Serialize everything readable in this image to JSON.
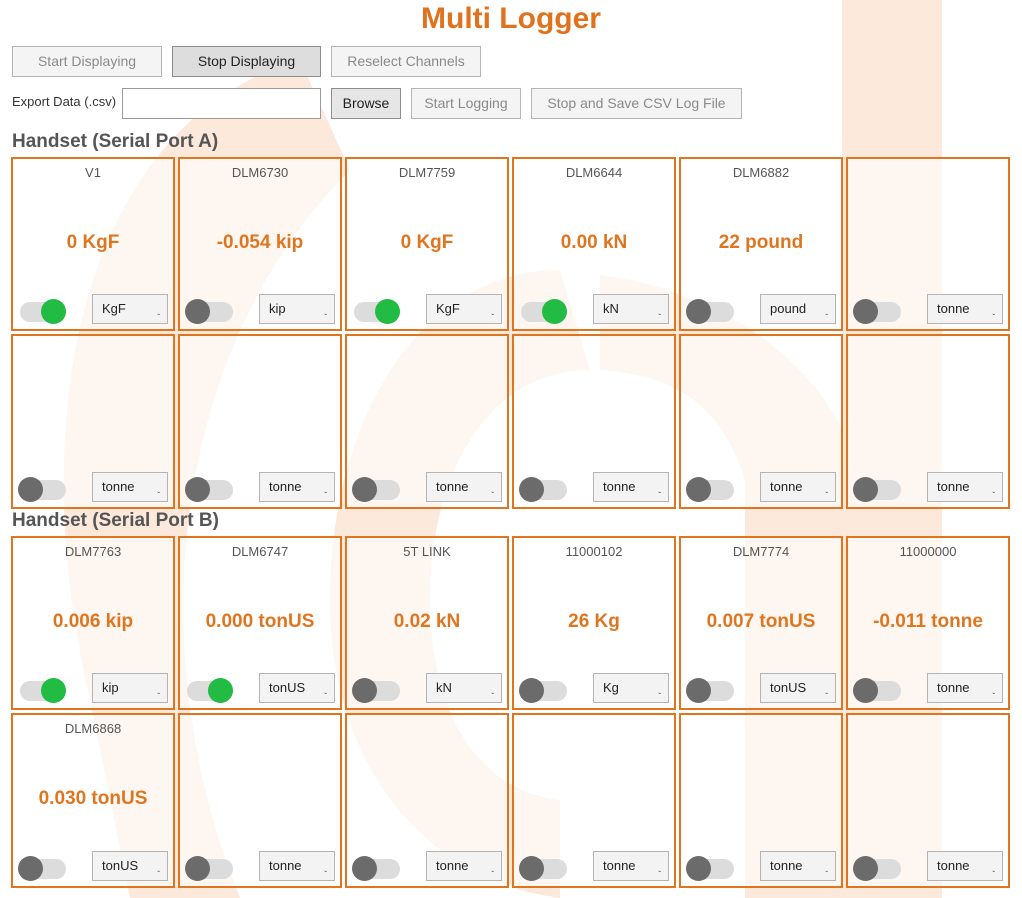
{
  "title": "Multi Logger",
  "toolbar": {
    "start_displaying": "Start Displaying",
    "stop_displaying": "Stop Displaying",
    "reselect_channels": "Reselect Channels",
    "export_label": "Export Data (.csv)",
    "export_value": "",
    "browse": "Browse",
    "start_logging": "Start Logging",
    "stop_save": "Stop and Save CSV Log File"
  },
  "colors": {
    "accent": "#e07520",
    "toggle_on": "#22bb44",
    "toggle_off": "#6b6b6b"
  },
  "sections": [
    {
      "title": "Handset (Serial Port A)",
      "channels": [
        {
          "name": "V1",
          "value": "0 KgF",
          "unit": "KgF",
          "enabled": true
        },
        {
          "name": "DLM6730",
          "value": "-0.054 kip",
          "unit": "kip",
          "enabled": false
        },
        {
          "name": "DLM7759",
          "value": "0 KgF",
          "unit": "KgF",
          "enabled": true
        },
        {
          "name": "DLM6644",
          "value": "0.00 kN",
          "unit": "kN",
          "enabled": true
        },
        {
          "name": "DLM6882",
          "value": "22 pound",
          "unit": "pound",
          "enabled": false
        },
        {
          "name": "",
          "value": "",
          "unit": "tonne",
          "enabled": false
        },
        {
          "name": "",
          "value": "",
          "unit": "tonne",
          "enabled": false
        },
        {
          "name": "",
          "value": "",
          "unit": "tonne",
          "enabled": false
        },
        {
          "name": "",
          "value": "",
          "unit": "tonne",
          "enabled": false
        },
        {
          "name": "",
          "value": "",
          "unit": "tonne",
          "enabled": false
        },
        {
          "name": "",
          "value": "",
          "unit": "tonne",
          "enabled": false
        },
        {
          "name": "",
          "value": "",
          "unit": "tonne",
          "enabled": false
        }
      ]
    },
    {
      "title": "Handset (Serial Port B)",
      "channels": [
        {
          "name": "DLM7763",
          "value": "0.006 kip",
          "unit": "kip",
          "enabled": true
        },
        {
          "name": "DLM6747",
          "value": "0.000 tonUS",
          "unit": "tonUS",
          "enabled": true
        },
        {
          "name": "5T LINK",
          "value": "0.02 kN",
          "unit": "kN",
          "enabled": false
        },
        {
          "name": "11000102",
          "value": "26 Kg",
          "unit": "Kg",
          "enabled": false
        },
        {
          "name": "DLM7774",
          "value": "0.007 tonUS",
          "unit": "tonUS",
          "enabled": false
        },
        {
          "name": "11000000",
          "value": "-0.011 tonne",
          "unit": "tonne",
          "enabled": false
        },
        {
          "name": "DLM6868",
          "value": "0.030 tonUS",
          "unit": "tonUS",
          "enabled": false
        },
        {
          "name": "",
          "value": "",
          "unit": "tonne",
          "enabled": false
        },
        {
          "name": "",
          "value": "",
          "unit": "tonne",
          "enabled": false
        },
        {
          "name": "",
          "value": "",
          "unit": "tonne",
          "enabled": false
        },
        {
          "name": "",
          "value": "",
          "unit": "tonne",
          "enabled": false
        },
        {
          "name": "",
          "value": "",
          "unit": "tonne",
          "enabled": false
        }
      ]
    }
  ]
}
